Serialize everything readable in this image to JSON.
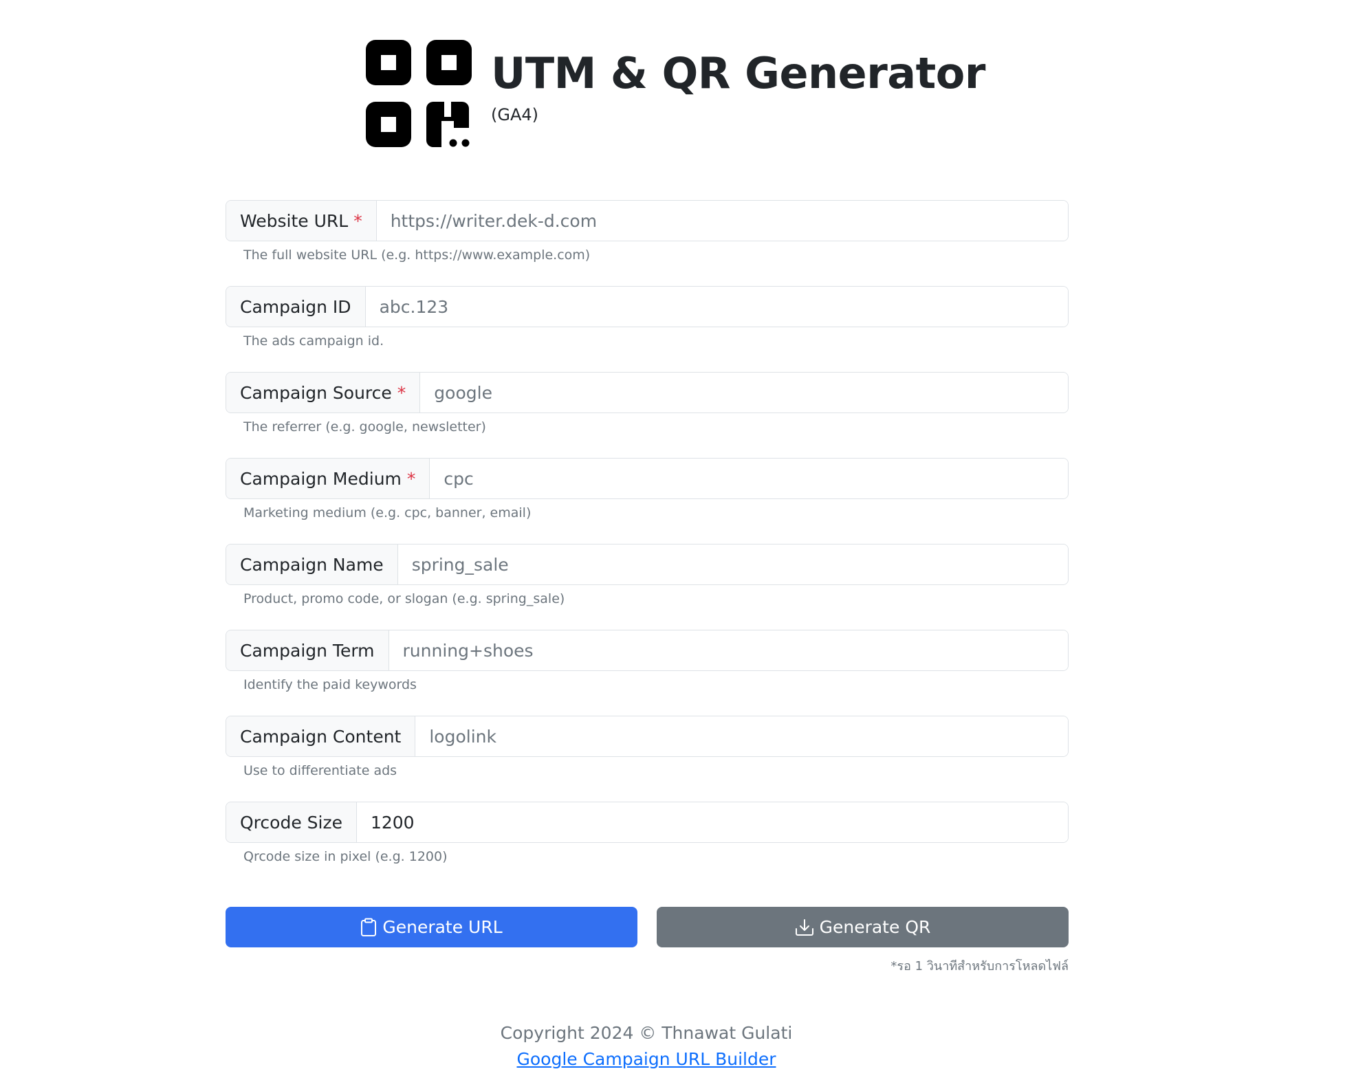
{
  "header": {
    "title": "UTM & QR Generator",
    "subtitle": "(GA4)",
    "logo_icon": "qr-code-icon"
  },
  "form": {
    "fields": [
      {
        "label": "Website URL",
        "required": true,
        "value": "https://writer.dek-d.com",
        "help": "The full website URL (e.g. https://www.example.com)"
      },
      {
        "label": "Campaign ID",
        "required": false,
        "value": "abc.123",
        "help": "The ads campaign id."
      },
      {
        "label": "Campaign Source",
        "required": true,
        "value": "google",
        "help": "The referrer (e.g. google, newsletter)"
      },
      {
        "label": "Campaign Medium",
        "required": true,
        "value": "cpc",
        "help": "Marketing medium (e.g. cpc, banner, email)"
      },
      {
        "label": "Campaign Name",
        "required": false,
        "value": "spring_sale",
        "help": "Product, promo code, or slogan (e.g. spring_sale)"
      },
      {
        "label": "Campaign Term",
        "required": false,
        "value": "running+shoes",
        "help": "Identify the paid keywords"
      },
      {
        "label": "Campaign Content",
        "required": false,
        "value": "logolink",
        "help": "Use to differentiate ads"
      },
      {
        "label": "Qrcode Size",
        "required": false,
        "value": "1200",
        "help": "Qrcode size in pixel (e.g. 1200)"
      }
    ],
    "required_marker": "*"
  },
  "actions": {
    "generate_url_label": "Generate URL",
    "generate_url_icon": "clipboard-icon",
    "generate_qr_label": "Generate QR",
    "generate_qr_icon": "download-icon",
    "note": "*รอ 1 วินาทีสำหรับการโหลดไฟล์"
  },
  "footer": {
    "copyright": "Copyright 2024 © Thnawat Gulati",
    "link_text": "Google Campaign URL Builder"
  },
  "colors": {
    "primary": "#3370f0",
    "secondary": "#6c757d",
    "required": "#dc3545",
    "link": "#0d6efd"
  }
}
